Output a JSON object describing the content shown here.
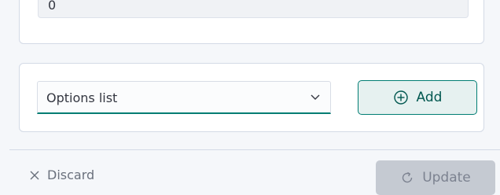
{
  "number_field": {
    "value": "0"
  },
  "options": {
    "select_value": "Options list",
    "add_label": "Add"
  },
  "footer": {
    "discard_label": "Discard",
    "update_label": "Update"
  },
  "colors": {
    "accent": "#017d73",
    "add_bg": "#e6f1f0",
    "update_bg": "#c5cad2"
  },
  "icons": {
    "chevron": "chevron-down-icon",
    "add": "plus-circle-icon",
    "discard": "close-icon",
    "update": "refresh-icon"
  }
}
